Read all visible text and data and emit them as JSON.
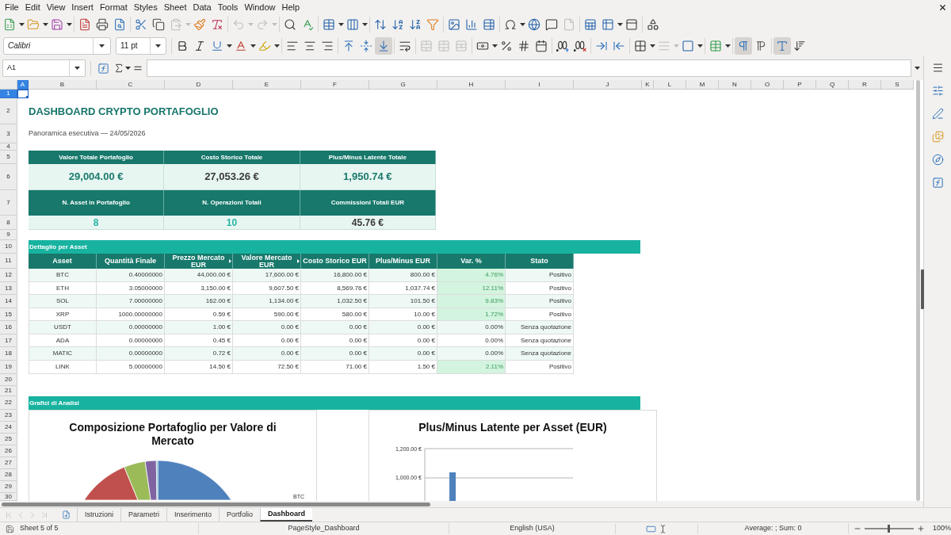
{
  "menu_bar": [
    "File",
    "Edit",
    "View",
    "Insert",
    "Format",
    "Styles",
    "Sheet",
    "Data",
    "Tools",
    "Window",
    "Help"
  ],
  "standard_toolbar": [
    {
      "kind": "new",
      "disabled": false
    },
    {
      "kind": "open",
      "disabled": false
    },
    {
      "kind": "save",
      "disabled": false
    },
    {
      "kind": "export_pdf",
      "disabled": false
    },
    {
      "kind": "print",
      "disabled": false
    },
    {
      "kind": "print_preview",
      "disabled": false
    },
    {
      "kind": "cut",
      "disabled": false
    },
    {
      "kind": "copy",
      "disabled": false
    },
    {
      "kind": "paste",
      "disabled": true
    },
    {
      "kind": "clone_formatting",
      "disabled": false
    },
    {
      "kind": "clear_formatting",
      "disabled": false
    },
    {
      "kind": "undo",
      "disabled": true
    },
    {
      "kind": "redo",
      "disabled": true
    },
    {
      "kind": "find_replace",
      "disabled": false
    },
    {
      "kind": "spelling",
      "disabled": false
    },
    {
      "kind": "rows",
      "disabled": false
    },
    {
      "kind": "columns",
      "disabled": false
    },
    {
      "kind": "sort",
      "disabled": false
    },
    {
      "kind": "sort_ascending",
      "disabled": false
    },
    {
      "kind": "sort_descending",
      "disabled": false
    },
    {
      "kind": "autofilter",
      "disabled": false
    },
    {
      "kind": "image",
      "disabled": false
    },
    {
      "kind": "chart",
      "disabled": false
    },
    {
      "kind": "pivot_table",
      "disabled": false
    },
    {
      "kind": "special_character",
      "disabled": false
    },
    {
      "kind": "hyperlink",
      "disabled": false
    },
    {
      "kind": "comment",
      "disabled": false
    },
    {
      "kind": "header_footer",
      "disabled": true
    },
    {
      "kind": "print_area",
      "disabled": false
    },
    {
      "kind": "freeze",
      "disabled": false
    },
    {
      "kind": "split_window",
      "disabled": false
    },
    {
      "kind": "draw_functions",
      "disabled": false
    }
  ],
  "formatting_toolbar": {
    "font_name": "Calibri",
    "font_size": "11 pt",
    "tools": [
      {
        "kind": "bold",
        "disabled": false,
        "pressed": false
      },
      {
        "kind": "italic",
        "disabled": false,
        "pressed": false
      },
      {
        "kind": "underline",
        "disabled": false,
        "pressed": false
      },
      {
        "kind": "font_color",
        "disabled": false,
        "pressed": false
      },
      {
        "kind": "highlighting",
        "disabled": false,
        "pressed": false
      },
      {
        "kind": "align_left",
        "disabled": false,
        "pressed": false
      },
      {
        "kind": "align_center",
        "disabled": false,
        "pressed": false
      },
      {
        "kind": "align_right",
        "disabled": false,
        "pressed": false
      },
      {
        "kind": "align_top",
        "disabled": false,
        "pressed": false
      },
      {
        "kind": "align_middle",
        "disabled": false,
        "pressed": false
      },
      {
        "kind": "align_bottom",
        "disabled": false,
        "pressed": true
      },
      {
        "kind": "wrap_text",
        "disabled": false,
        "pressed": false
      },
      {
        "kind": "merge_center",
        "disabled": true,
        "pressed": false
      },
      {
        "kind": "merge_cells",
        "disabled": true,
        "pressed": false
      },
      {
        "kind": "unmerge",
        "disabled": true,
        "pressed": false
      },
      {
        "kind": "currency",
        "disabled": false,
        "pressed": false
      },
      {
        "kind": "percent",
        "disabled": false,
        "pressed": false
      },
      {
        "kind": "number",
        "disabled": false,
        "pressed": false
      },
      {
        "kind": "date",
        "disabled": false,
        "pressed": false
      },
      {
        "kind": "add_decimal",
        "disabled": false,
        "pressed": false
      },
      {
        "kind": "delete_decimal",
        "disabled": false,
        "pressed": false
      },
      {
        "kind": "increase_indent",
        "disabled": false,
        "pressed": false
      },
      {
        "kind": "decrease_indent",
        "disabled": false,
        "pressed": false
      },
      {
        "kind": "borders",
        "disabled": false,
        "pressed": false
      },
      {
        "kind": "border_style",
        "disabled": true,
        "pressed": false
      },
      {
        "kind": "border_color",
        "disabled": false,
        "pressed": false
      },
      {
        "kind": "conditional",
        "disabled": false,
        "pressed": false
      },
      {
        "kind": "left_to_right",
        "disabled": false,
        "pressed": true
      },
      {
        "kind": "right_to_left",
        "disabled": false,
        "pressed": false
      },
      {
        "kind": "text_left_to_right",
        "disabled": false,
        "pressed": true
      },
      {
        "kind": "text_top_to_bottom",
        "disabled": false,
        "pressed": false
      }
    ]
  },
  "formula_bar": {
    "cell_reference": "A1"
  },
  "sheet": {
    "columns": [
      {
        "label": "A",
        "selected": true
      },
      {
        "label": "B",
        "selected": false
      },
      {
        "label": "C",
        "selected": false
      },
      {
        "label": "D",
        "selected": false
      },
      {
        "label": "E",
        "selected": false
      },
      {
        "label": "F",
        "selected": false
      },
      {
        "label": "G",
        "selected": false
      },
      {
        "label": "H",
        "selected": false
      },
      {
        "label": "I",
        "selected": false
      },
      {
        "label": "J",
        "selected": false
      },
      {
        "label": "K",
        "selected": false
      },
      {
        "label": "L",
        "selected": false
      },
      {
        "label": "M",
        "selected": false
      },
      {
        "label": "N",
        "selected": false
      },
      {
        "label": "O",
        "selected": false
      },
      {
        "label": "P",
        "selected": false
      },
      {
        "label": "Q",
        "selected": false
      },
      {
        "label": "R",
        "selected": false
      },
      {
        "label": "S",
        "selected": false
      }
    ],
    "rows": [
      {
        "label": "1",
        "selected": true
      },
      {
        "label": "2",
        "selected": false
      },
      {
        "label": "3",
        "selected": false
      },
      {
        "label": "4",
        "selected": false
      },
      {
        "label": "5",
        "selected": false
      },
      {
        "label": "6",
        "selected": false
      },
      {
        "label": "7",
        "selected": false
      },
      {
        "label": "8",
        "selected": false
      },
      {
        "label": "9",
        "selected": false
      },
      {
        "label": "10",
        "selected": false
      },
      {
        "label": "11",
        "selected": false
      },
      {
        "label": "12",
        "selected": false
      },
      {
        "label": "13",
        "selected": false
      },
      {
        "label": "14",
        "selected": false
      },
      {
        "label": "15",
        "selected": false
      },
      {
        "label": "16",
        "selected": false
      },
      {
        "label": "17",
        "selected": false
      },
      {
        "label": "18",
        "selected": false
      },
      {
        "label": "19",
        "selected": false
      },
      {
        "label": "20",
        "selected": false
      },
      {
        "label": "21",
        "selected": false
      },
      {
        "label": "22",
        "selected": false
      },
      {
        "label": "23",
        "selected": false
      },
      {
        "label": "24",
        "selected": false
      },
      {
        "label": "25",
        "selected": false
      },
      {
        "label": "26",
        "selected": false
      },
      {
        "label": "27",
        "selected": false
      },
      {
        "label": "28",
        "selected": false
      },
      {
        "label": "29",
        "selected": false
      },
      {
        "label": "30",
        "selected": false
      }
    ],
    "title": "DASHBOARD CRYPTO PORTAFOGLIO",
    "subtitle": "Panoramica esecutiva — 24/05/2026",
    "kpi_rows": [
      [
        {
          "label": "Valore Totale Portafoglio",
          "value": "29,004.00 €",
          "color": "#1b7a6c"
        },
        {
          "label": "Costo Storico Totale",
          "value": "27,053.26 €",
          "color": "#3a3a3a"
        },
        {
          "label": "Plus/Minus Latente Totale",
          "value": "1,950.74 €",
          "color": "#1b7a6c"
        }
      ],
      [
        {
          "label": "N. Asset in Portafoglio",
          "value": "8",
          "color": "#26b3a3"
        },
        {
          "label": "N. Operazioni Totali",
          "value": "10",
          "color": "#26b3a3"
        },
        {
          "label": "Commissioni Totali EUR",
          "value": "45.76 €",
          "color": "#3a3a3a"
        }
      ]
    ],
    "asset_section": {
      "title": "Dettaglio per Asset",
      "columns": [
        {
          "label": "Asset",
          "clipped": false
        },
        {
          "label": "Quantità Finale",
          "clipped": false
        },
        {
          "label": "Prezzo Mercato EUR",
          "clipped": true
        },
        {
          "label": "Valore Mercato EUR",
          "clipped": true
        },
        {
          "label": "Costo Storico EUR",
          "clipped": false
        },
        {
          "label": "Plus/Minus EUR",
          "clipped": false
        },
        {
          "label": "Var. %",
          "clipped": false
        },
        {
          "label": "Stato",
          "clipped": false
        }
      ],
      "rows": [
        {
          "cells": [
            "BTC",
            "0.40000000",
            "44,000.00 €",
            "17,600.00 €",
            "16,800.00 €",
            "800.00 €",
            "4.76%",
            "Positivo"
          ],
          "var_highlighted": true
        },
        {
          "cells": [
            "ETH",
            "3.05000000",
            "3,150.00 €",
            "9,607.50 €",
            "8,569.76 €",
            "1,037.74 €",
            "12.11%",
            "Positivo"
          ],
          "var_highlighted": true
        },
        {
          "cells": [
            "SOL",
            "7.00000000",
            "162.00 €",
            "1,134.00 €",
            "1,032.50 €",
            "101.50 €",
            "9.83%",
            "Positivo"
          ],
          "var_highlighted": true
        },
        {
          "cells": [
            "XRP",
            "1000.00000000",
            "0.59 €",
            "590.00 €",
            "580.00 €",
            "10.00 €",
            "1.72%",
            "Positivo"
          ],
          "var_highlighted": true
        },
        {
          "cells": [
            "USDT",
            "0.00000000",
            "1.00 €",
            "0.00 €",
            "0.00 €",
            "0.00 €",
            "0.00%",
            "Senza quotazione"
          ],
          "var_highlighted": false
        },
        {
          "cells": [
            "ADA",
            "0.00000000",
            "0.45 €",
            "0.00 €",
            "0.00 €",
            "0.00 €",
            "0.00%",
            "Senza quotazione"
          ],
          "var_highlighted": false
        },
        {
          "cells": [
            "MATIC",
            "0.00000000",
            "0.72 €",
            "0.00 €",
            "0.00 €",
            "0.00 €",
            "0.00%",
            "Senza quotazione"
          ],
          "var_highlighted": false
        },
        {
          "cells": [
            "LINK",
            "5.00000000",
            "14.50 €",
            "72.50 €",
            "71.00 €",
            "1.50 €",
            "2.11%",
            "Positivo"
          ],
          "var_highlighted": true
        }
      ]
    },
    "charts_section": {
      "title": "Grafici di Analisi",
      "charts": [
        {
          "kind": "pie",
          "title": "Composizione Portafoglio per Valore di Mercato",
          "legend": [
            "BTC"
          ]
        },
        {
          "chart_data": {
            "type": "bar",
            "title": "Plus/Minus Latente per Asset (EUR)",
            "values": [
              null,
              1038,
              null,
              null,
              null,
              null,
              null,
              null
            ],
            "ylim": [
              843,
              1200
            ],
            "yticks": [
              {
                "value": 1000,
                "label": "1,000.00 €"
              },
              {
                "value": 1200,
                "label": "1,200.00 €"
              }
            ]
          }
        }
      ]
    }
  },
  "sheet_navigation": [
    {
      "kind": "first",
      "disabled": true
    },
    {
      "kind": "previous",
      "disabled": true
    },
    {
      "kind": "next",
      "disabled": true
    },
    {
      "kind": "last",
      "disabled": true
    }
  ],
  "sheet_tabs": [
    {
      "label": "Istruzioni",
      "selected": false
    },
    {
      "label": "Parametri",
      "selected": false
    },
    {
      "label": "Inserimento",
      "selected": false
    },
    {
      "label": "Portfolio",
      "selected": false
    },
    {
      "label": "Dashboard",
      "selected": true
    }
  ],
  "status_bar": {
    "sheet_position": "Sheet 5 of 5",
    "page_style": "PageStyle_Dashboard",
    "language": "English (USA)",
    "selection_summary": "Average: ; Sum: 0",
    "zoom": {
      "level": 0.5,
      "reading": "100%"
    }
  }
}
